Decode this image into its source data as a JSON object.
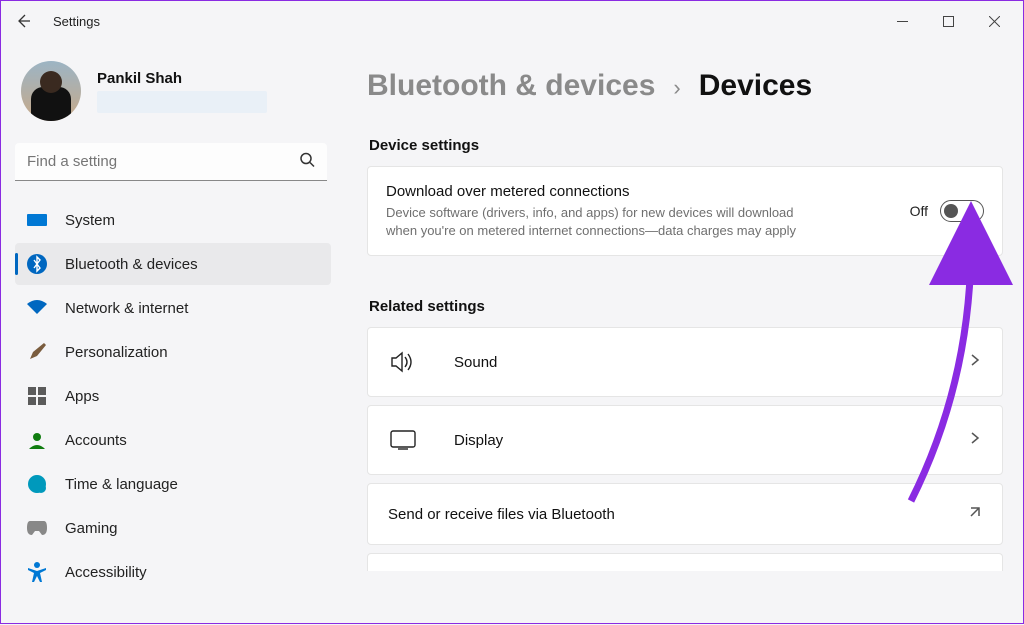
{
  "app_title": "Settings",
  "profile": {
    "name": "Pankil Shah"
  },
  "search": {
    "placeholder": "Find a setting"
  },
  "sidebar": {
    "items": [
      {
        "label": "System"
      },
      {
        "label": "Bluetooth & devices"
      },
      {
        "label": "Network & internet"
      },
      {
        "label": "Personalization"
      },
      {
        "label": "Apps"
      },
      {
        "label": "Accounts"
      },
      {
        "label": "Time & language"
      },
      {
        "label": "Gaming"
      },
      {
        "label": "Accessibility"
      }
    ],
    "selected_index": 1
  },
  "breadcrumb": {
    "parent": "Bluetooth & devices",
    "current": "Devices"
  },
  "sections": {
    "device_settings_title": "Device settings",
    "metered": {
      "title": "Download over metered connections",
      "desc": "Device software (drivers, info, and apps) for new devices will download when you're on metered internet connections—data charges may apply",
      "state_label": "Off"
    },
    "related_title": "Related settings",
    "related": [
      {
        "label": "Sound"
      },
      {
        "label": "Display"
      },
      {
        "label": "Send or receive files via Bluetooth"
      }
    ]
  }
}
